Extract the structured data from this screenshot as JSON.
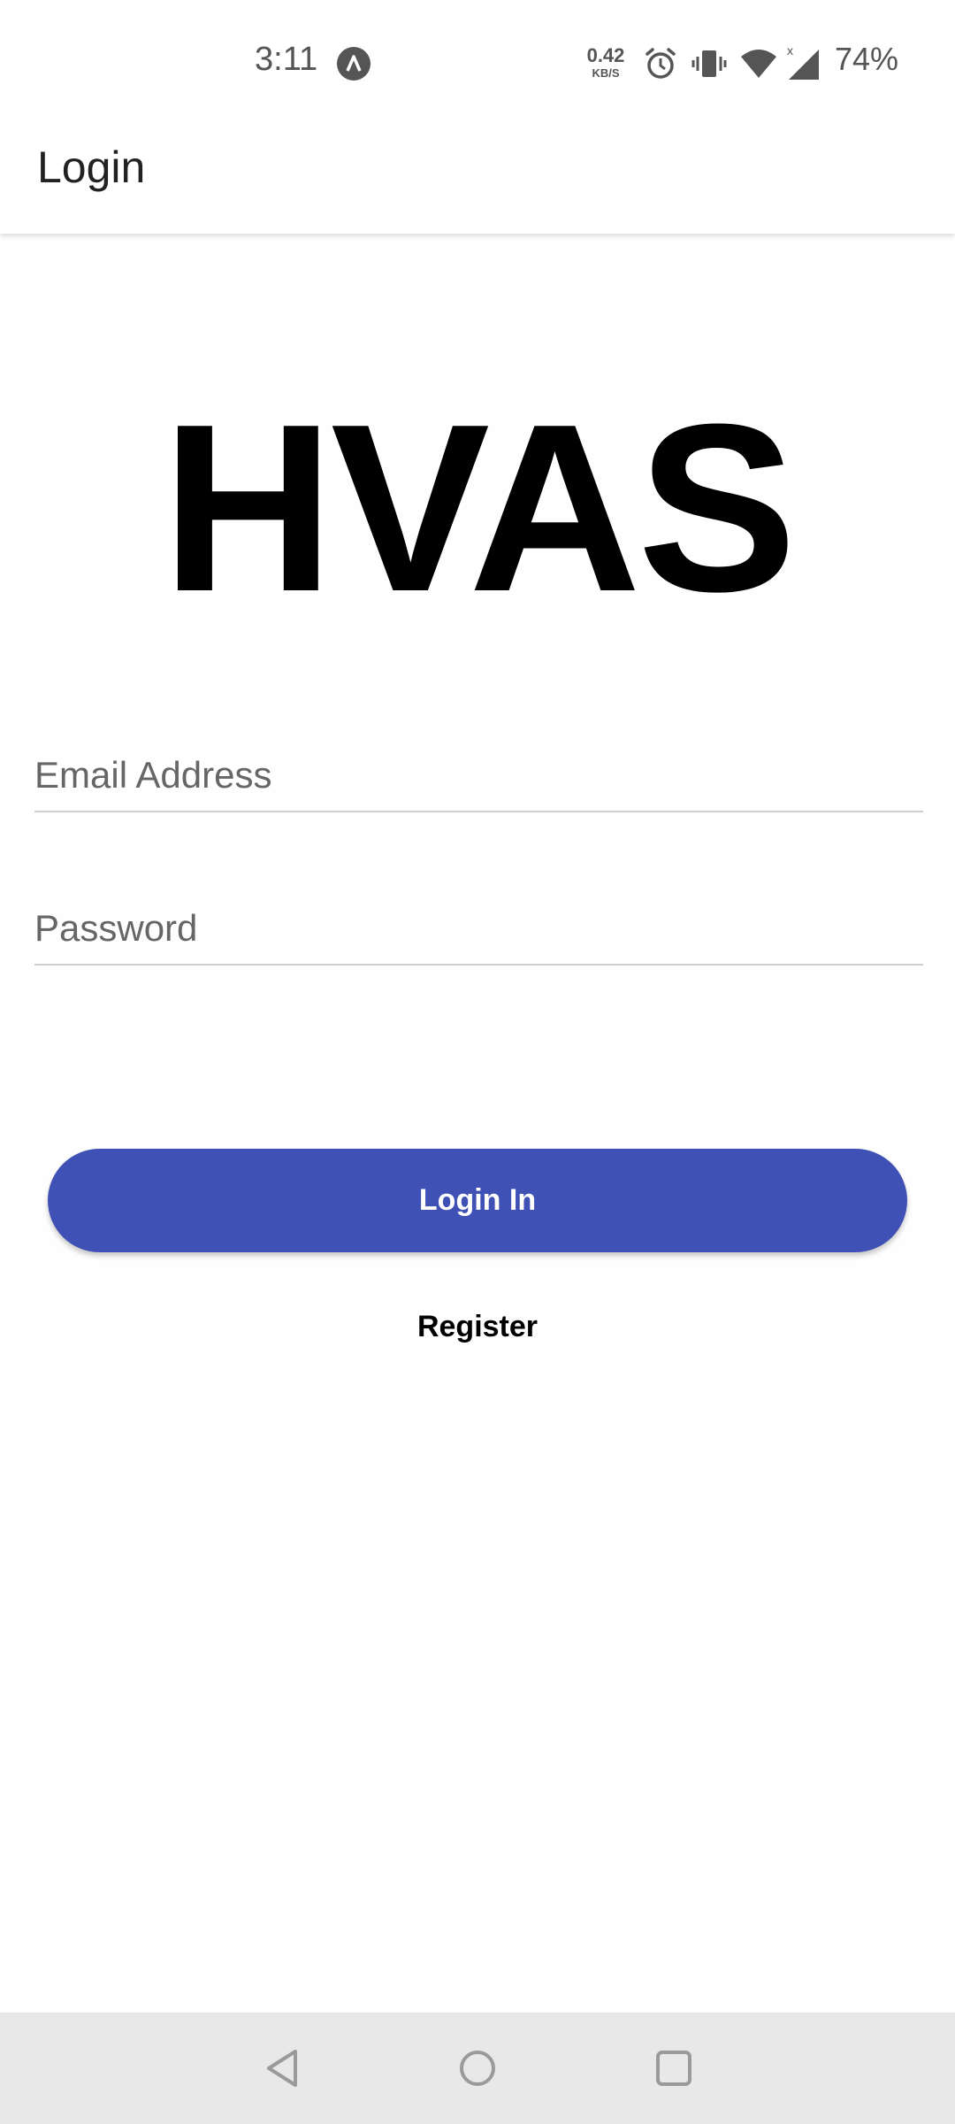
{
  "status_bar": {
    "time": "3:11",
    "net_speed_value": "0.42",
    "net_speed_unit": "KB/S",
    "battery": "74%",
    "icons": [
      "app-notification-icon",
      "alarm-icon",
      "vibrate-icon",
      "wifi-icon",
      "signal-icon"
    ]
  },
  "app_bar": {
    "title": "Login"
  },
  "logo": {
    "text": "HVAS"
  },
  "form": {
    "email_placeholder": "Email Address",
    "email_value": "",
    "password_placeholder": "Password",
    "password_value": "",
    "login_label": "Login In",
    "register_label": "Register"
  },
  "colors": {
    "primary": "#3f51b5",
    "background": "#fefefe",
    "nav_bar": "#e8e8e8"
  },
  "nav_bar": {
    "icons": [
      "back-icon",
      "home-icon",
      "recents-icon"
    ]
  }
}
